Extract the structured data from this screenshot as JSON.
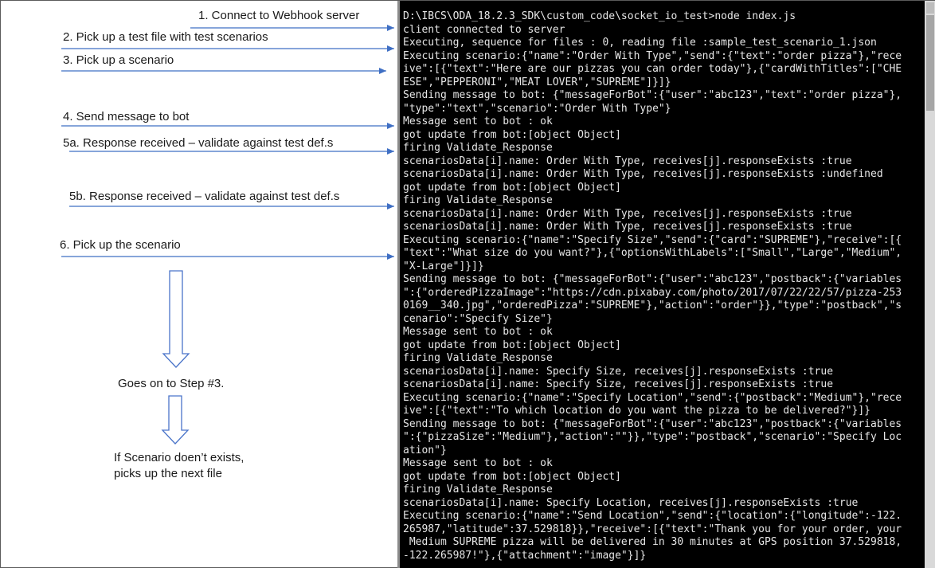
{
  "steps": [
    "1. Connect to Webhook server",
    "2. Pick up a test file with test scenarios",
    "3. Pick up a scenario",
    "4. Send message to bot",
    "5a. Response received – validate against test def.s",
    "5b. Response received – validate against test def.s",
    "6. Pick up the scenario"
  ],
  "flow_notes": {
    "goes_on": "Goes on to Step #3.",
    "no_scenario_line1": "If Scenario doen’t exists,",
    "no_scenario_line2": "picks up the next file"
  },
  "console": {
    "lines": [
      "D:\\IBCS\\ODA_18.2.3_SDK\\custom_code\\socket_io_test>node index.js",
      "client connected to server",
      "Executing, sequence for files : 0, reading file :sample_test_scenario_1.json",
      "Executing scenario:{\"name\":\"Order With Type\",\"send\":{\"text\":\"order pizza\"},\"rece",
      "ive\":[{\"text\":\"Here are our pizzas you can order today\"},{\"cardWithTitles\":[\"CHE",
      "ESE\",\"PEPPERONI\",\"MEAT LOVER\",\"SUPREME\"]}]}",
      "Sending message to bot: {\"messageForBot\":{\"user\":\"abc123\",\"text\":\"order pizza\"},",
      "\"type\":\"text\",\"scenario\":\"Order With Type\"}",
      "Message sent to bot : ok",
      "got update from bot:[object Object]",
      "firing Validate_Response",
      "scenariosData[i].name: Order With Type, receives[j].responseExists :true",
      "scenariosData[i].name: Order With Type, receives[j].responseExists :undefined",
      "got update from bot:[object Object]",
      "firing Validate_Response",
      "scenariosData[i].name: Order With Type, receives[j].responseExists :true",
      "scenariosData[i].name: Order With Type, receives[j].responseExists :true",
      "Executing scenario:{\"name\":\"Specify Size\",\"send\":{\"card\":\"SUPREME\"},\"receive\":[{",
      "\"text\":\"What size do you want?\"},{\"optionsWithLabels\":[\"Small\",\"Large\",\"Medium\",",
      "\"X-Large\"]}]}",
      "Sending message to bot: {\"messageForBot\":{\"user\":\"abc123\",\"postback\":{\"variables",
      "\":{\"orderedPizzaImage\":\"https://cdn.pixabay.com/photo/2017/07/22/22/57/pizza-253",
      "0169__340.jpg\",\"orderedPizza\":\"SUPREME\"},\"action\":\"order\"}},\"type\":\"postback\",\"s",
      "cenario\":\"Specify Size\"}",
      "Message sent to bot : ok",
      "got update from bot:[object Object]",
      "firing Validate_Response",
      "scenariosData[i].name: Specify Size, receives[j].responseExists :true",
      "scenariosData[i].name: Specify Size, receives[j].responseExists :true",
      "Executing scenario:{\"name\":\"Specify Location\",\"send\":{\"postback\":\"Medium\"},\"rece",
      "ive\":[{\"text\":\"To which location do you want the pizza to be delivered?\"}]}",
      "Sending message to bot: {\"messageForBot\":{\"user\":\"abc123\",\"postback\":{\"variables",
      "\":{\"pizzaSize\":\"Medium\"},\"action\":\"\"}},\"type\":\"postback\",\"scenario\":\"Specify Loc",
      "ation\"}",
      "Message sent to bot : ok",
      "got update from bot:[object Object]",
      "firing Validate_Response",
      "scenariosData[i].name: Specify Location, receives[j].responseExists :true",
      "Executing scenario:{\"name\":\"Send Location\",\"send\":{\"location\":{\"longitude\":-122.",
      "265987,\"latitude\":37.529818}},\"receive\":[{\"text\":\"Thank you for your order, your",
      " Medium SUPREME pizza will be delivered in 30 minutes at GPS position 37.529818,",
      "-122.265987!\"},{\"attachment\":\"image\"}]}"
    ]
  },
  "colors": {
    "arrow": "#3f6fc4",
    "flow_arrow": "#4a74c9",
    "console_bg": "#000000",
    "console_text": "#e6e6e6"
  }
}
